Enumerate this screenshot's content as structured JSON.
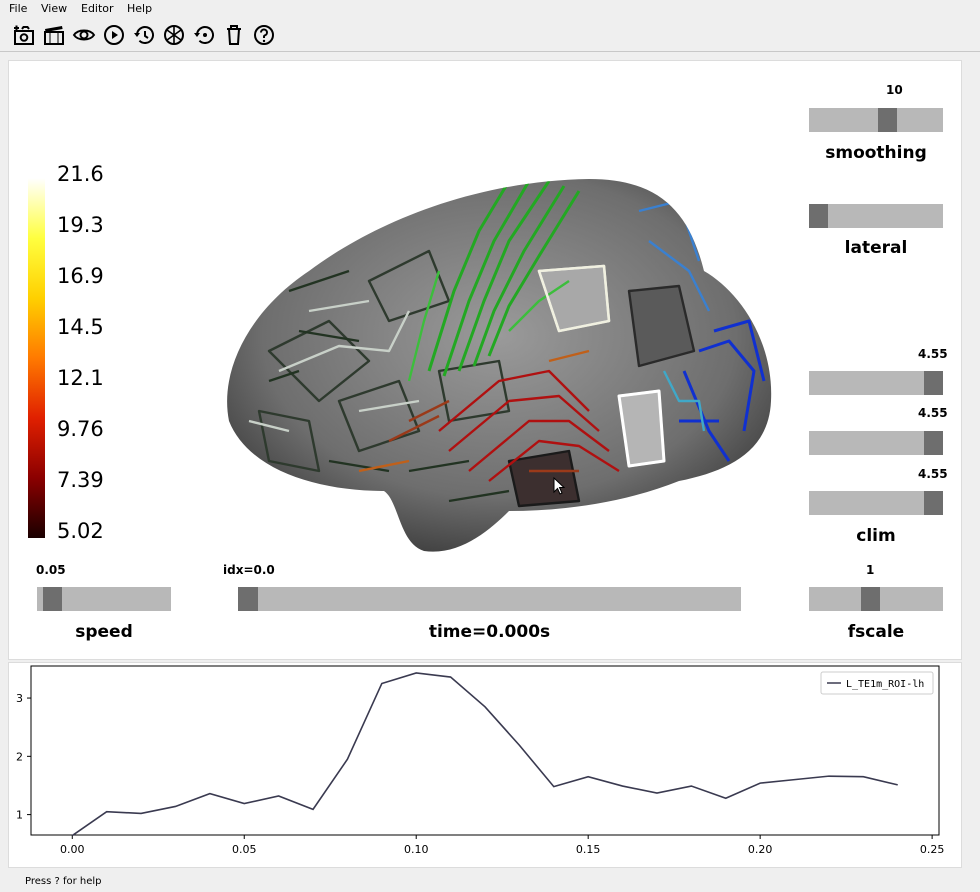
{
  "menu": {
    "items": [
      "File",
      "View",
      "Editor",
      "Help"
    ]
  },
  "toolbar": {
    "icons": [
      "screenshot-icon",
      "movie-icon",
      "visibility-icon",
      "play-icon",
      "reset-icon",
      "restore-icon",
      "reset-view-icon",
      "clear-icon",
      "help-icon"
    ]
  },
  "colorbar": {
    "ticks": [
      "21.6",
      "19.3",
      "16.9",
      "14.5",
      "12.1",
      "9.76",
      "7.39",
      "5.02"
    ],
    "colors": [
      "#1a0000",
      "#8b0000",
      "#e02000",
      "#ff7a00",
      "#ffd000",
      "#ffff40",
      "#ffffff"
    ]
  },
  "sliders": {
    "smoothing": {
      "label": "smoothing",
      "value_text": "10",
      "fraction": 0.6
    },
    "lateral": {
      "label": "lateral",
      "fraction": 0.0
    },
    "clim": {
      "label": "clim",
      "values": [
        "4.55",
        "4.55",
        "4.55"
      ],
      "fraction": 1.0
    },
    "fscale": {
      "label": "fscale",
      "value_text": "1",
      "fraction": 0.45
    },
    "speed": {
      "label": "speed",
      "value_text": "0.05",
      "fraction": 0.05
    },
    "time": {
      "label": "time=0.000s",
      "value_text": "idx=0.0",
      "fraction": 0.0
    }
  },
  "chart_data": {
    "type": "line",
    "title": "",
    "xlabel": "",
    "ylabel": "",
    "xlim": [
      -0.012,
      0.252
    ],
    "ylim": [
      0.65,
      3.55
    ],
    "xticks": [
      "0.00",
      "0.05",
      "0.10",
      "0.15",
      "0.20",
      "0.25"
    ],
    "xtick_values": [
      0.0,
      0.05,
      0.1,
      0.15,
      0.2,
      0.25
    ],
    "yticks": [
      "1",
      "2",
      "3"
    ],
    "ytick_values": [
      1,
      2,
      3
    ],
    "legend_position": "top-right",
    "series": [
      {
        "name": "L_TE1m_ROI-lh",
        "color": "#3a3a50",
        "x": [
          0.0,
          0.01,
          0.02,
          0.03,
          0.04,
          0.05,
          0.06,
          0.07,
          0.08,
          0.09,
          0.1,
          0.11,
          0.12,
          0.13,
          0.14,
          0.15,
          0.16,
          0.17,
          0.18,
          0.19,
          0.2,
          0.21,
          0.22,
          0.23,
          0.24
        ],
        "y": [
          0.64,
          1.05,
          1.02,
          1.14,
          1.36,
          1.19,
          1.32,
          1.09,
          1.95,
          3.25,
          3.43,
          3.36,
          2.85,
          2.19,
          1.48,
          1.65,
          1.49,
          1.37,
          1.49,
          1.28,
          1.54,
          1.6,
          1.66,
          1.65,
          1.51
        ]
      }
    ]
  },
  "status": {
    "text": "Press ? for help"
  }
}
